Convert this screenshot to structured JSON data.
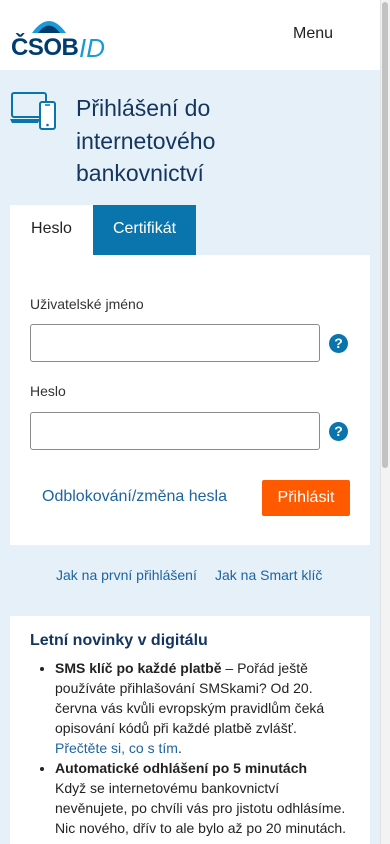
{
  "header": {
    "logo_text": "ČSOB",
    "logo_id": "ID",
    "menu_label": "Menu"
  },
  "page": {
    "title": "Přihlášení do internetového bankovnictví"
  },
  "tabs": [
    {
      "label": "Heslo",
      "active": true
    },
    {
      "label": "Certifikát",
      "active": false
    }
  ],
  "form": {
    "username_label": "Uživatelské jméno",
    "username_value": "",
    "password_label": "Heslo",
    "password_value": "",
    "help_symbol": "?",
    "unlock_link": "Odblokování/změna hesla",
    "login_button": "Přihlásit"
  },
  "links": {
    "first_login": "Jak na první přihlášení",
    "smart_key": "Jak na Smart klíč"
  },
  "news": {
    "title": "Letní novinky v digitálu",
    "items": [
      {
        "bold": "SMS klíč po každé platbě",
        "text": " – Pořád ještě používáte přihlašování SMSkami? Od 20. června vás kvůli evropským pravidlům čeká opisování kódů při každé platbě zvlášť.",
        "link": "Přečtěte si, co s tím",
        "after": "."
      },
      {
        "bold": "Automatické odhlášení po 5 minutách",
        "text": " Když se internetovému bankovnictví nevěnujete, po chvíli vás pro jistotu odhlásíme. Nic nového, dřív to ale bylo až po 20 minutách.",
        "link": "",
        "after": ""
      }
    ]
  },
  "colors": {
    "brand_dark": "#003d6e",
    "brand_light": "#1a9bd7",
    "tab_active_bg": "#0a74ad",
    "login_button": "#ff5a00",
    "link": "#1d64a0",
    "page_bg": "#e6f0f8"
  }
}
